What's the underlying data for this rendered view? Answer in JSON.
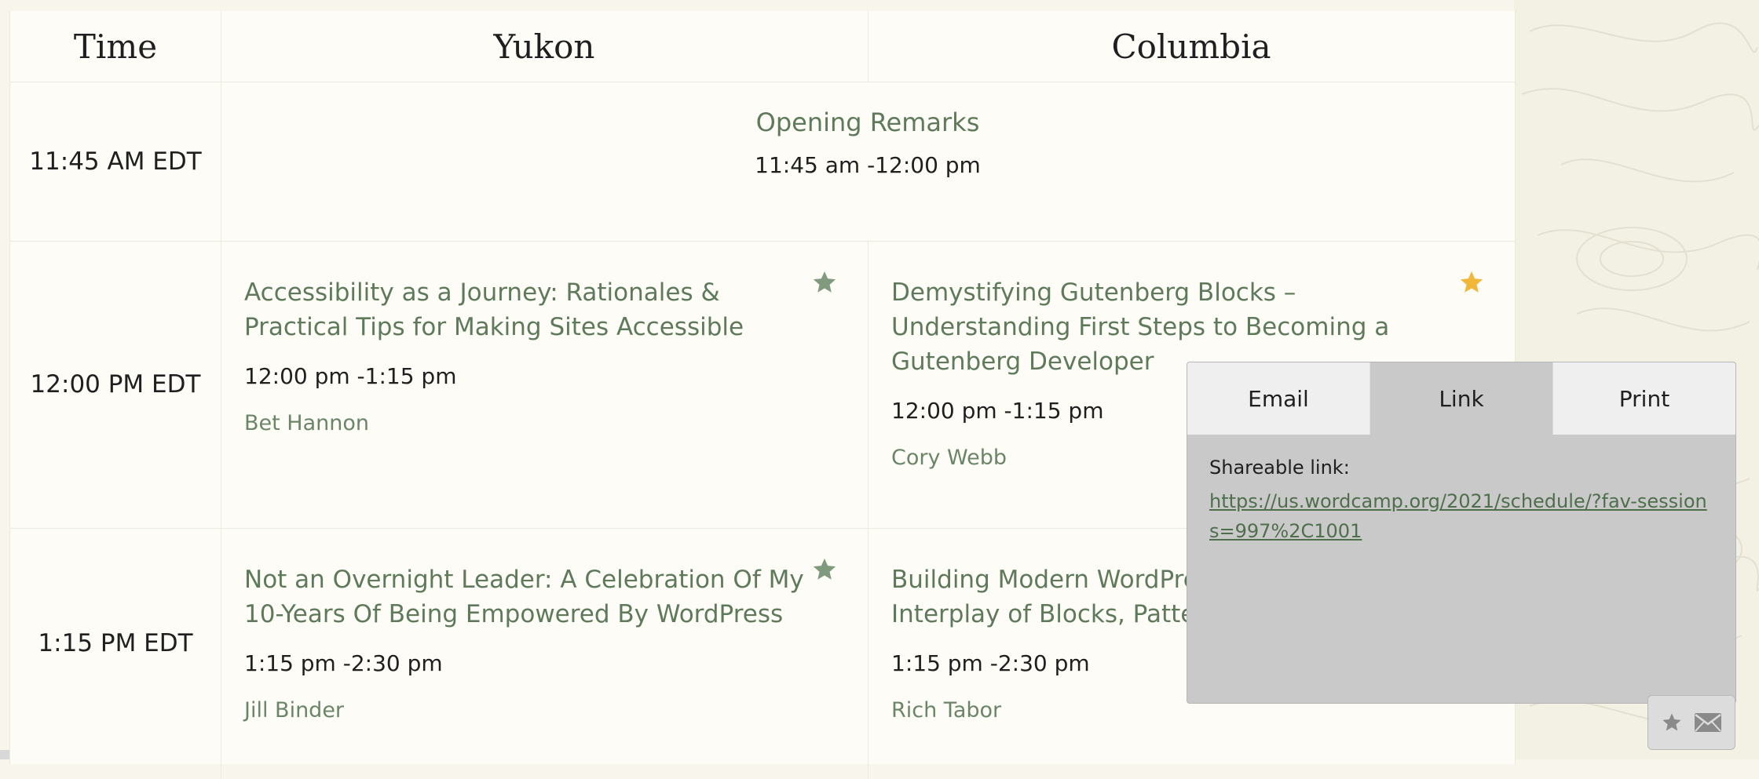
{
  "header": {
    "time": "Time",
    "yukon": "Yukon",
    "columbia": "Columbia"
  },
  "rows": [
    {
      "time": "11:45 AM EDT",
      "span": {
        "title": "Opening Remarks",
        "time": "11:45 am -12:00 pm"
      }
    },
    {
      "time": "12:00 PM EDT",
      "yukon": {
        "title": "Accessibility as a Journey: Rationales & Practical Tips for Making Sites Accessible",
        "time": "12:00 pm -1:15 pm",
        "speaker": "Bet Hannon",
        "favorite": false
      },
      "columbia": {
        "title": "Demystifying Gutenberg Blocks – Understanding First Steps to Becoming a Gutenberg Developer",
        "time": "12:00 pm -1:15 pm",
        "speaker": "Cory Webb",
        "favorite": true
      }
    },
    {
      "time": "1:15 PM EDT",
      "yukon": {
        "title": "Not an Overnight Leader: A Celebration Of My 10-Years Of Being Empowered By WordPress",
        "time": "1:15 pm -2:30 pm",
        "speaker": "Jill Binder",
        "favorite": false
      },
      "columbia": {
        "title": "Building Modern WordPre",
        "title_line2": "Interplay of Blocks, Patte",
        "time": "1:15 pm -2:30 pm",
        "speaker": "Rich Tabor",
        "favorite": false
      }
    }
  ],
  "share_popup": {
    "tabs": [
      "Email",
      "Link",
      "Print"
    ],
    "active_tab": "Link",
    "label": "Shareable link:",
    "link": "https://us.wordcamp.org/2021/schedule/?fav-sessions=997%2C1001"
  },
  "icons": {
    "star_inactive": "star-icon",
    "star_active": "star-icon",
    "fab_star": "star-icon",
    "fab_mail": "envelope-icon"
  },
  "colors": {
    "accent": "#5e7a5b",
    "star_active": "#f0b73a",
    "star_inactive": "#7f9a7c",
    "popup_bg": "#c9c9c9"
  }
}
